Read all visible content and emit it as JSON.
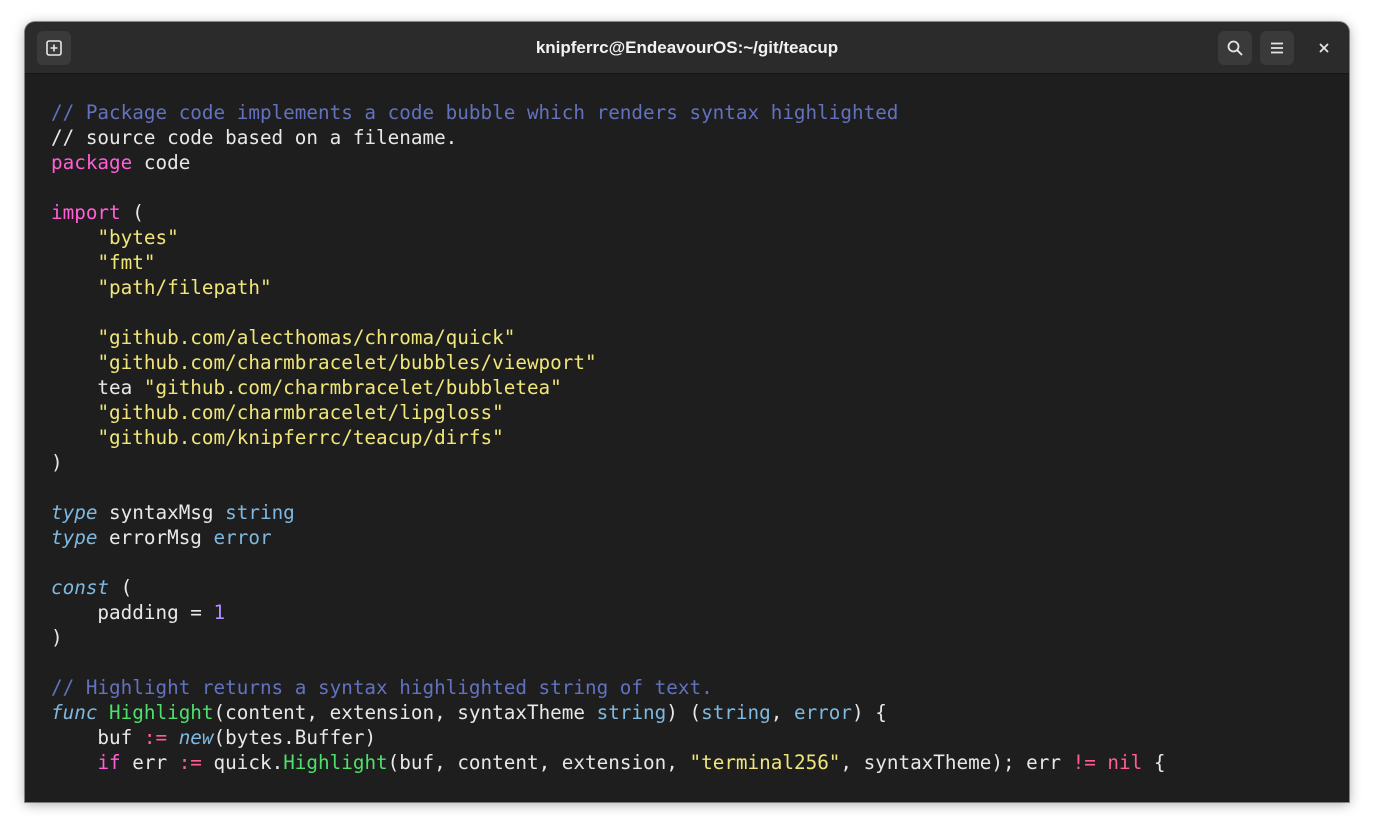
{
  "window": {
    "title": "knipferrc@EndeavourOS:~/git/teacup",
    "icons": {
      "new_tab": "new-tab-icon",
      "search": "search-icon",
      "menu": "hamburger-menu-icon",
      "close": "close-icon"
    }
  },
  "code": {
    "lines": [
      [
        {
          "t": "// Package code implements a code bubble which renders syntax highlighted",
          "c": "cm"
        }
      ],
      [
        {
          "t": "// source code based on a filename.",
          "c": ""
        }
      ],
      [
        {
          "t": "package",
          "c": "kw"
        },
        {
          "t": " code",
          "c": ""
        }
      ],
      [],
      [
        {
          "t": "import",
          "c": "kw"
        },
        {
          "t": " (",
          "c": ""
        }
      ],
      [
        {
          "t": "    ",
          "c": ""
        },
        {
          "t": "\"bytes\"",
          "c": "st"
        }
      ],
      [
        {
          "t": "    ",
          "c": ""
        },
        {
          "t": "\"fmt\"",
          "c": "st"
        }
      ],
      [
        {
          "t": "    ",
          "c": ""
        },
        {
          "t": "\"path/filepath\"",
          "c": "st"
        }
      ],
      [],
      [
        {
          "t": "    ",
          "c": ""
        },
        {
          "t": "\"github.com/alecthomas/chroma/quick\"",
          "c": "st"
        }
      ],
      [
        {
          "t": "    ",
          "c": ""
        },
        {
          "t": "\"github.com/charmbracelet/bubbles/viewport\"",
          "c": "st"
        }
      ],
      [
        {
          "t": "    tea ",
          "c": ""
        },
        {
          "t": "\"github.com/charmbracelet/bubbletea\"",
          "c": "st"
        }
      ],
      [
        {
          "t": "    ",
          "c": ""
        },
        {
          "t": "\"github.com/charmbracelet/lipgloss\"",
          "c": "st"
        }
      ],
      [
        {
          "t": "    ",
          "c": ""
        },
        {
          "t": "\"github.com/knipferrc/teacup/dirfs\"",
          "c": "st"
        }
      ],
      [
        {
          "t": ")",
          "c": ""
        }
      ],
      [],
      [
        {
          "t": "type",
          "c": "ty"
        },
        {
          "t": " syntaxMsg ",
          "c": ""
        },
        {
          "t": "string",
          "c": "bt"
        }
      ],
      [
        {
          "t": "type",
          "c": "ty"
        },
        {
          "t": " errorMsg ",
          "c": ""
        },
        {
          "t": "error",
          "c": "bt"
        }
      ],
      [],
      [
        {
          "t": "const",
          "c": "ty"
        },
        {
          "t": " (",
          "c": ""
        }
      ],
      [
        {
          "t": "    padding = ",
          "c": ""
        },
        {
          "t": "1",
          "c": "nu"
        }
      ],
      [
        {
          "t": ")",
          "c": ""
        }
      ],
      [],
      [
        {
          "t": "// Highlight returns a syntax highlighted string of text.",
          "c": "cm"
        }
      ],
      [
        {
          "t": "func",
          "c": "ty"
        },
        {
          "t": " ",
          "c": ""
        },
        {
          "t": "Highlight",
          "c": "fn"
        },
        {
          "t": "(content, extension, syntaxTheme ",
          "c": ""
        },
        {
          "t": "string",
          "c": "bt"
        },
        {
          "t": ") (",
          "c": ""
        },
        {
          "t": "string",
          "c": "bt"
        },
        {
          "t": ", ",
          "c": ""
        },
        {
          "t": "error",
          "c": "bt"
        },
        {
          "t": ") {",
          "c": ""
        }
      ],
      [
        {
          "t": "    buf ",
          "c": ""
        },
        {
          "t": ":=",
          "c": "op"
        },
        {
          "t": " ",
          "c": ""
        },
        {
          "t": "new",
          "c": "ty"
        },
        {
          "t": "(bytes.Buffer)",
          "c": ""
        }
      ],
      [
        {
          "t": "    ",
          "c": ""
        },
        {
          "t": "if",
          "c": "kw"
        },
        {
          "t": " err ",
          "c": ""
        },
        {
          "t": ":=",
          "c": "op"
        },
        {
          "t": " quick.",
          "c": ""
        },
        {
          "t": "Highlight",
          "c": "fn"
        },
        {
          "t": "(buf, content, extension, ",
          "c": ""
        },
        {
          "t": "\"terminal256\"",
          "c": "st"
        },
        {
          "t": ", syntaxTheme); err ",
          "c": ""
        },
        {
          "t": "!=",
          "c": "op"
        },
        {
          "t": " ",
          "c": ""
        },
        {
          "t": "nil",
          "c": "nl"
        },
        {
          "t": " {",
          "c": ""
        }
      ]
    ]
  }
}
